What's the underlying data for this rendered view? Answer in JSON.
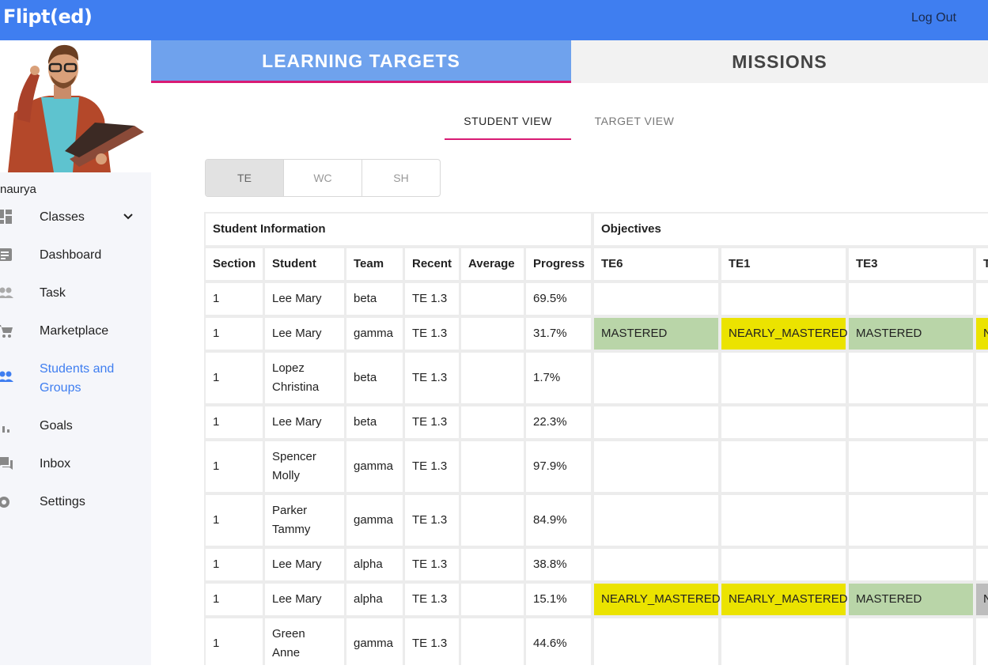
{
  "app": {
    "logo": "Flipt(ed)",
    "logout": "Log Out"
  },
  "user": {
    "name": "naurya"
  },
  "sidebar": {
    "items": [
      {
        "label": "Classes",
        "icon": "dashboard-grid-icon"
      },
      {
        "label": "Dashboard",
        "icon": "list-icon"
      },
      {
        "label": "Task",
        "icon": "people-icon"
      },
      {
        "label": "Marketplace",
        "icon": "cart-icon"
      },
      {
        "label": "Students and Groups",
        "icon": "group-icon",
        "active": true
      },
      {
        "label": "Goals",
        "icon": "bar-chart-icon"
      },
      {
        "label": "Inbox",
        "icon": "chat-icon"
      },
      {
        "label": "Settings",
        "icon": "gear-icon"
      }
    ]
  },
  "tabs": {
    "learning_targets": "LEARNING TARGETS",
    "missions": "MISSIONS"
  },
  "subtabs": {
    "student_view": "STUDENT VIEW",
    "target_view": "TARGET VIEW"
  },
  "segments": [
    "TE",
    "WC",
    "SH"
  ],
  "table": {
    "group_headers": {
      "student_info": "Student Information",
      "objectives": "Objectives"
    },
    "columns": [
      "Section",
      "Student",
      "Team",
      "Recent",
      "Average",
      "Progress",
      "TE6",
      "TE1",
      "TE3",
      "T"
    ],
    "rows": [
      {
        "section": "1",
        "student": "Lee Mary",
        "team": "beta",
        "recent": "TE 1.3",
        "average": "",
        "progress": "69.5%",
        "te6": "",
        "te1": "",
        "te3": "",
        "t": ""
      },
      {
        "section": "1",
        "student": "Lee Mary",
        "team": "gamma",
        "recent": "TE 1.3",
        "average": "",
        "progress": "31.7%",
        "te6": "MASTERED",
        "te1": "NEARLY_MASTERED",
        "te3": "MASTERED",
        "t": "N"
      },
      {
        "section": "1",
        "student": "Lopez Christina",
        "team": "beta",
        "recent": "TE 1.3",
        "average": "",
        "progress": "1.7%",
        "te6": "",
        "te1": "",
        "te3": "",
        "t": ""
      },
      {
        "section": "1",
        "student": "Lee Mary",
        "team": "beta",
        "recent": "TE 1.3",
        "average": "",
        "progress": "22.3%",
        "te6": "",
        "te1": "",
        "te3": "",
        "t": ""
      },
      {
        "section": "1",
        "student": "Spencer Molly",
        "team": "gamma",
        "recent": "TE 1.3",
        "average": "",
        "progress": "97.9%",
        "te6": "",
        "te1": "",
        "te3": "",
        "t": ""
      },
      {
        "section": "1",
        "student": "Parker Tammy",
        "team": "gamma",
        "recent": "TE 1.3",
        "average": "",
        "progress": "84.9%",
        "te6": "",
        "te1": "",
        "te3": "",
        "t": ""
      },
      {
        "section": "1",
        "student": "Lee Mary",
        "team": "alpha",
        "recent": "TE 1.3",
        "average": "",
        "progress": "38.8%",
        "te6": "",
        "te1": "",
        "te3": "",
        "t": ""
      },
      {
        "section": "1",
        "student": "Lee Mary",
        "team": "alpha",
        "recent": "TE 1.3",
        "average": "",
        "progress": "15.1%",
        "te6": "NEARLY_MASTERED",
        "te1": "NEARLY_MASTERED",
        "te3": "MASTERED",
        "t": "N"
      },
      {
        "section": "1",
        "student": "Green Anne",
        "team": "gamma",
        "recent": "TE 1.3",
        "average": "",
        "progress": "44.6%",
        "te6": "",
        "te1": "",
        "te3": "",
        "t": ""
      }
    ]
  },
  "colors": {
    "topbar": "#3f7ef0",
    "accent": "#d81b74",
    "mastered": "#b9d5a8",
    "nearly_mastered": "#ebe300"
  }
}
